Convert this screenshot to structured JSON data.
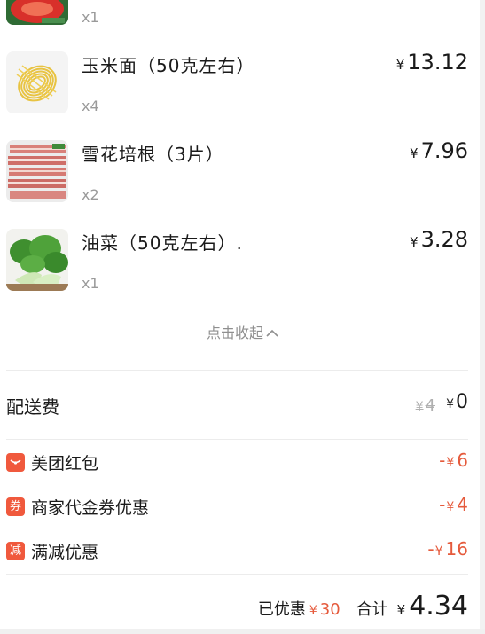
{
  "items": [
    {
      "name": "",
      "qty": "x1",
      "price": ""
    },
    {
      "name": "玉米面（50克左右）",
      "qty": "x4",
      "price": "13.12"
    },
    {
      "name": "雪花培根（3片）",
      "qty": "x2",
      "price": "7.96"
    },
    {
      "name": "油菜（50克左右）.",
      "qty": "x1",
      "price": "3.28"
    }
  ],
  "collapse_label": "点击收起",
  "currency": "¥",
  "delivery": {
    "label": "配送费",
    "original": "4",
    "current": "0"
  },
  "discounts": [
    {
      "icon_text": "",
      "icon": "red-envelope-icon",
      "label": "美团红包",
      "amount": "6"
    },
    {
      "icon_text": "券",
      "icon": "coupon-icon",
      "label": "商家代金券优惠",
      "amount": "4"
    },
    {
      "icon_text": "减",
      "icon": "discount-icon",
      "label": "满减优惠",
      "amount": "16"
    }
  ],
  "minus": "-",
  "summary": {
    "saved_label": "已优惠",
    "saved_amount": "30",
    "total_label": "合计",
    "total_amount": "4.34"
  },
  "colors": {
    "accent": "#e55a3c",
    "icon_bg": "#f0593d"
  }
}
